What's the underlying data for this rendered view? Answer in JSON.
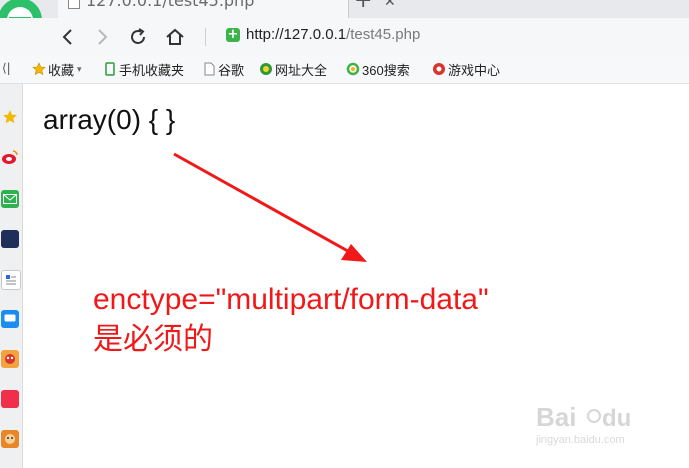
{
  "tab": {
    "title": "127.0.0.1/test45.php"
  },
  "toolbar": {
    "url_host": "http://127.0.0.1",
    "url_path": "/test45.php"
  },
  "bookmarks": [
    {
      "label": "收藏",
      "icon": "star-icon",
      "dropdown": true
    },
    {
      "label": "手机收藏夹",
      "icon": "phone-icon"
    },
    {
      "label": "谷歌",
      "icon": "page-icon"
    },
    {
      "label": "网址大全",
      "icon": "globe-icon"
    },
    {
      "label": "360搜索",
      "icon": "search-icon"
    },
    {
      "label": "游戏中心",
      "icon": "game-icon"
    }
  ],
  "page": {
    "output": "array(0) { }",
    "annotation_line1": "enctype=\"multipart/form-data\"",
    "annotation_line2": "是必须的"
  },
  "watermark": {
    "sub": "jingyan.baidu.com"
  },
  "colors": {
    "annotation": "#f01818",
    "secure": "#3cb44b"
  }
}
